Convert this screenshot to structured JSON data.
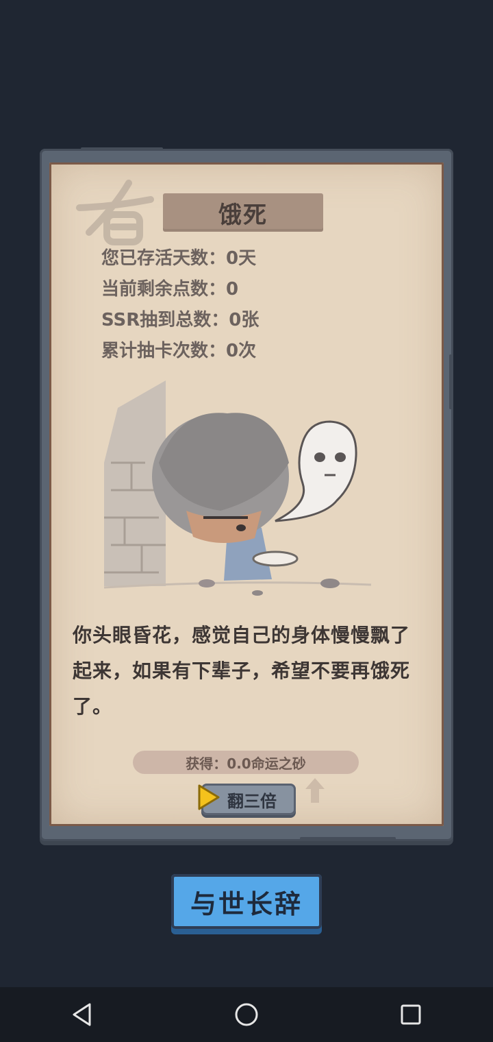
{
  "dialog": {
    "title": "饿死",
    "stats": [
      "您已存活天数：0天",
      "当前剩余点数：0",
      "SSR抽到总数：0张",
      "累计抽卡次数：0次"
    ],
    "story": "你头眼昏花，感觉自己的身体慢慢飘了起来，如果有下辈子，希望不要再饿死了。",
    "reward": "获得：0.0命运之砂",
    "triple_label": "翻三倍",
    "stamp_char": "有"
  },
  "actions": {
    "farewell_label": "与世长辞"
  },
  "navbar": {
    "icons": [
      "back-icon",
      "home-icon",
      "recents-icon"
    ]
  },
  "colors": {
    "background": "#1f2632",
    "paper": "#e6d6c0",
    "frame": "#5b6572",
    "button_blue": "#55a7e8",
    "play_yellow": "#f4c21c"
  }
}
